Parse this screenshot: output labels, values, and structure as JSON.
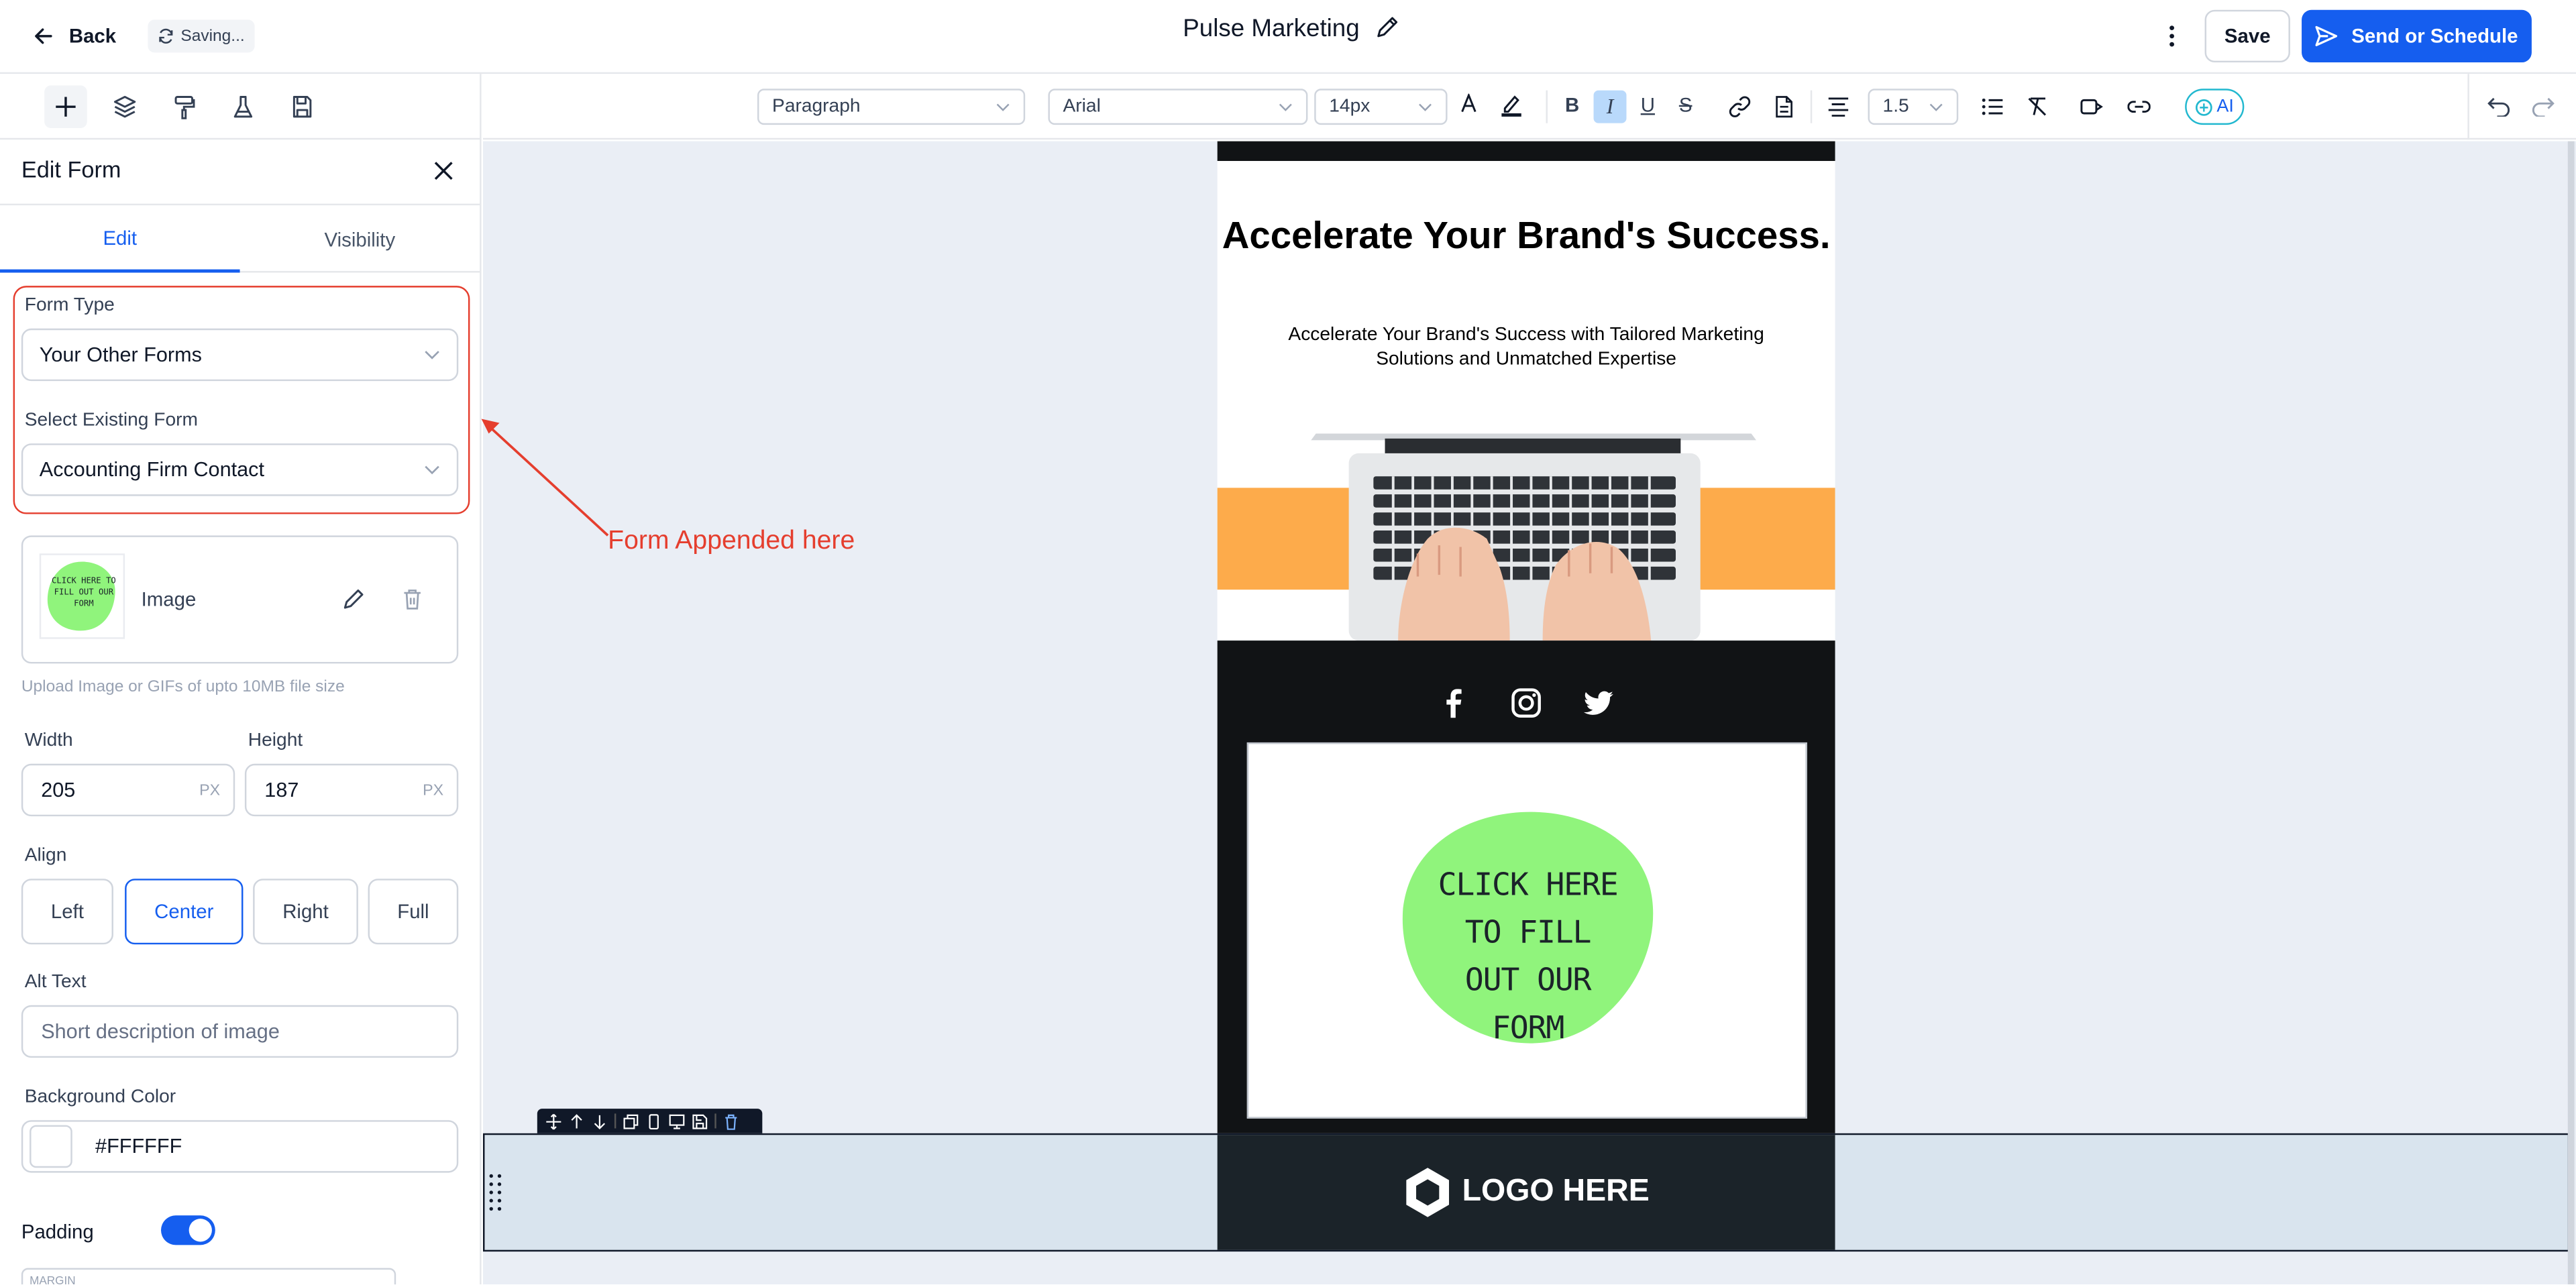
{
  "header": {
    "back_label": "Back",
    "saving_label": "Saving...",
    "title": "Pulse Marketing",
    "save_label": "Save",
    "send_label": "Send or Schedule"
  },
  "left_tools": [
    "plus-icon",
    "layers-icon",
    "paint-roller-icon",
    "flask-icon",
    "save-icon"
  ],
  "panel": {
    "title": "Edit Form",
    "tabs": [
      {
        "label": "Edit",
        "active": true
      },
      {
        "label": "Visibility",
        "active": false
      }
    ],
    "form_type_label": "Form Type",
    "form_type_value": "Your Other Forms",
    "existing_form_label": "Select Existing Form",
    "existing_form_value": "Accounting Firm Contact",
    "image_label": "Image",
    "thumb_text": "CLICK HERE TO FILL OUT OUR FORM",
    "upload_hint": "Upload Image or GIFs of upto 10MB file size",
    "width_label": "Width",
    "width_value": "205",
    "height_label": "Height",
    "height_value": "187",
    "unit": "PX",
    "align_label": "Align",
    "align_options": [
      {
        "label": "Left"
      },
      {
        "label": "Center",
        "active": true
      },
      {
        "label": "Right"
      },
      {
        "label": "Full"
      }
    ],
    "alt_label": "Alt Text",
    "alt_placeholder": "Short description of image",
    "bg_label": "Background Color",
    "bg_value": "#FFFFFF",
    "padding_label": "Padding",
    "padding_on": true,
    "margin_label": "MARGIN"
  },
  "toolbar": {
    "block_type": "Paragraph",
    "font": "Arial",
    "size": "14px",
    "line_height": "1.5",
    "ai_label": "AI"
  },
  "email": {
    "hero_title": "Accelerate Your Brand's Success.",
    "hero_subtitle": "Accelerate Your Brand's Success with Tailored Marketing Solutions and Unmatched Expertise",
    "form_image_text": "CLICK HERE TO FILL OUT OUR FORM",
    "footer_logo": "LOGO HERE"
  },
  "annotation": "Form Appended here",
  "colors": {
    "accent": "#155eef",
    "annotation_red": "#e53e2e",
    "orange_band": "#fdab4b",
    "form_green": "#90f47c",
    "email_dark": "#111315"
  }
}
